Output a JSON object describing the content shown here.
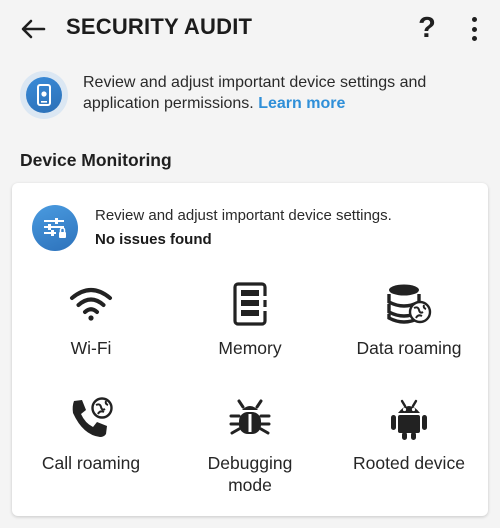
{
  "header": {
    "title": "SECURITY AUDIT",
    "help_label": "?"
  },
  "intro": {
    "text": "Review and adjust important device settings and application permissions.",
    "link": "Learn more"
  },
  "section": {
    "title": "Device Monitoring"
  },
  "card": {
    "description": "Review and adjust important device settings.",
    "status": "No issues found",
    "tiles": [
      {
        "label": "Wi-Fi",
        "icon": "wifi-icon"
      },
      {
        "label": "Memory",
        "icon": "memory-icon"
      },
      {
        "label": "Data roaming",
        "icon": "data-roaming-icon"
      },
      {
        "label": "Call roaming",
        "icon": "call-roaming-icon"
      },
      {
        "label": "Debugging mode",
        "icon": "bug-icon"
      },
      {
        "label": "Rooted device",
        "icon": "android-icon"
      }
    ]
  },
  "colors": {
    "accent": "#2f8fd8",
    "icon_blue": "#2d72bb",
    "background": "#f4f4f4"
  }
}
